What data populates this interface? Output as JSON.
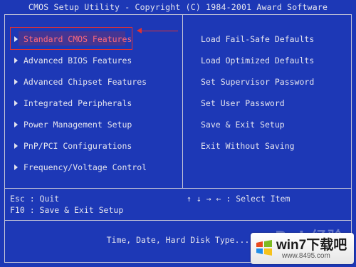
{
  "window": {
    "title": "CMOS Setup Utility - Copyright (C) 1984-2001 Award Software"
  },
  "left_menu": [
    {
      "label": "Standard CMOS Features",
      "selected": true
    },
    {
      "label": "Advanced BIOS Features"
    },
    {
      "label": "Advanced Chipset Features"
    },
    {
      "label": "Integrated Peripherals"
    },
    {
      "label": "Power Management Setup"
    },
    {
      "label": "PnP/PCI Configurations"
    },
    {
      "label": "Frequency/Voltage Control"
    }
  ],
  "right_menu": [
    {
      "label": "Load Fail-Safe Defaults"
    },
    {
      "label": "Load Optimized Defaults"
    },
    {
      "label": "Set Supervisor Password"
    },
    {
      "label": "Set User Password"
    },
    {
      "label": "Save & Exit Setup"
    },
    {
      "label": "Exit Without Saving"
    }
  ],
  "help": {
    "esc": "Esc : Quit",
    "f10": "F10 : Save & Exit Setup",
    "arrows": "↑ ↓ → ←   : Select Item"
  },
  "status_line": "Time, Date, Hard Disk Type...",
  "watermark": {
    "text": "Bai 经验",
    "site_name": "win7下载吧",
    "site_url": "www.8495.com"
  },
  "colors": {
    "background": "#1d38b6",
    "highlight": "#e03030",
    "text": "#e4e4ee"
  }
}
